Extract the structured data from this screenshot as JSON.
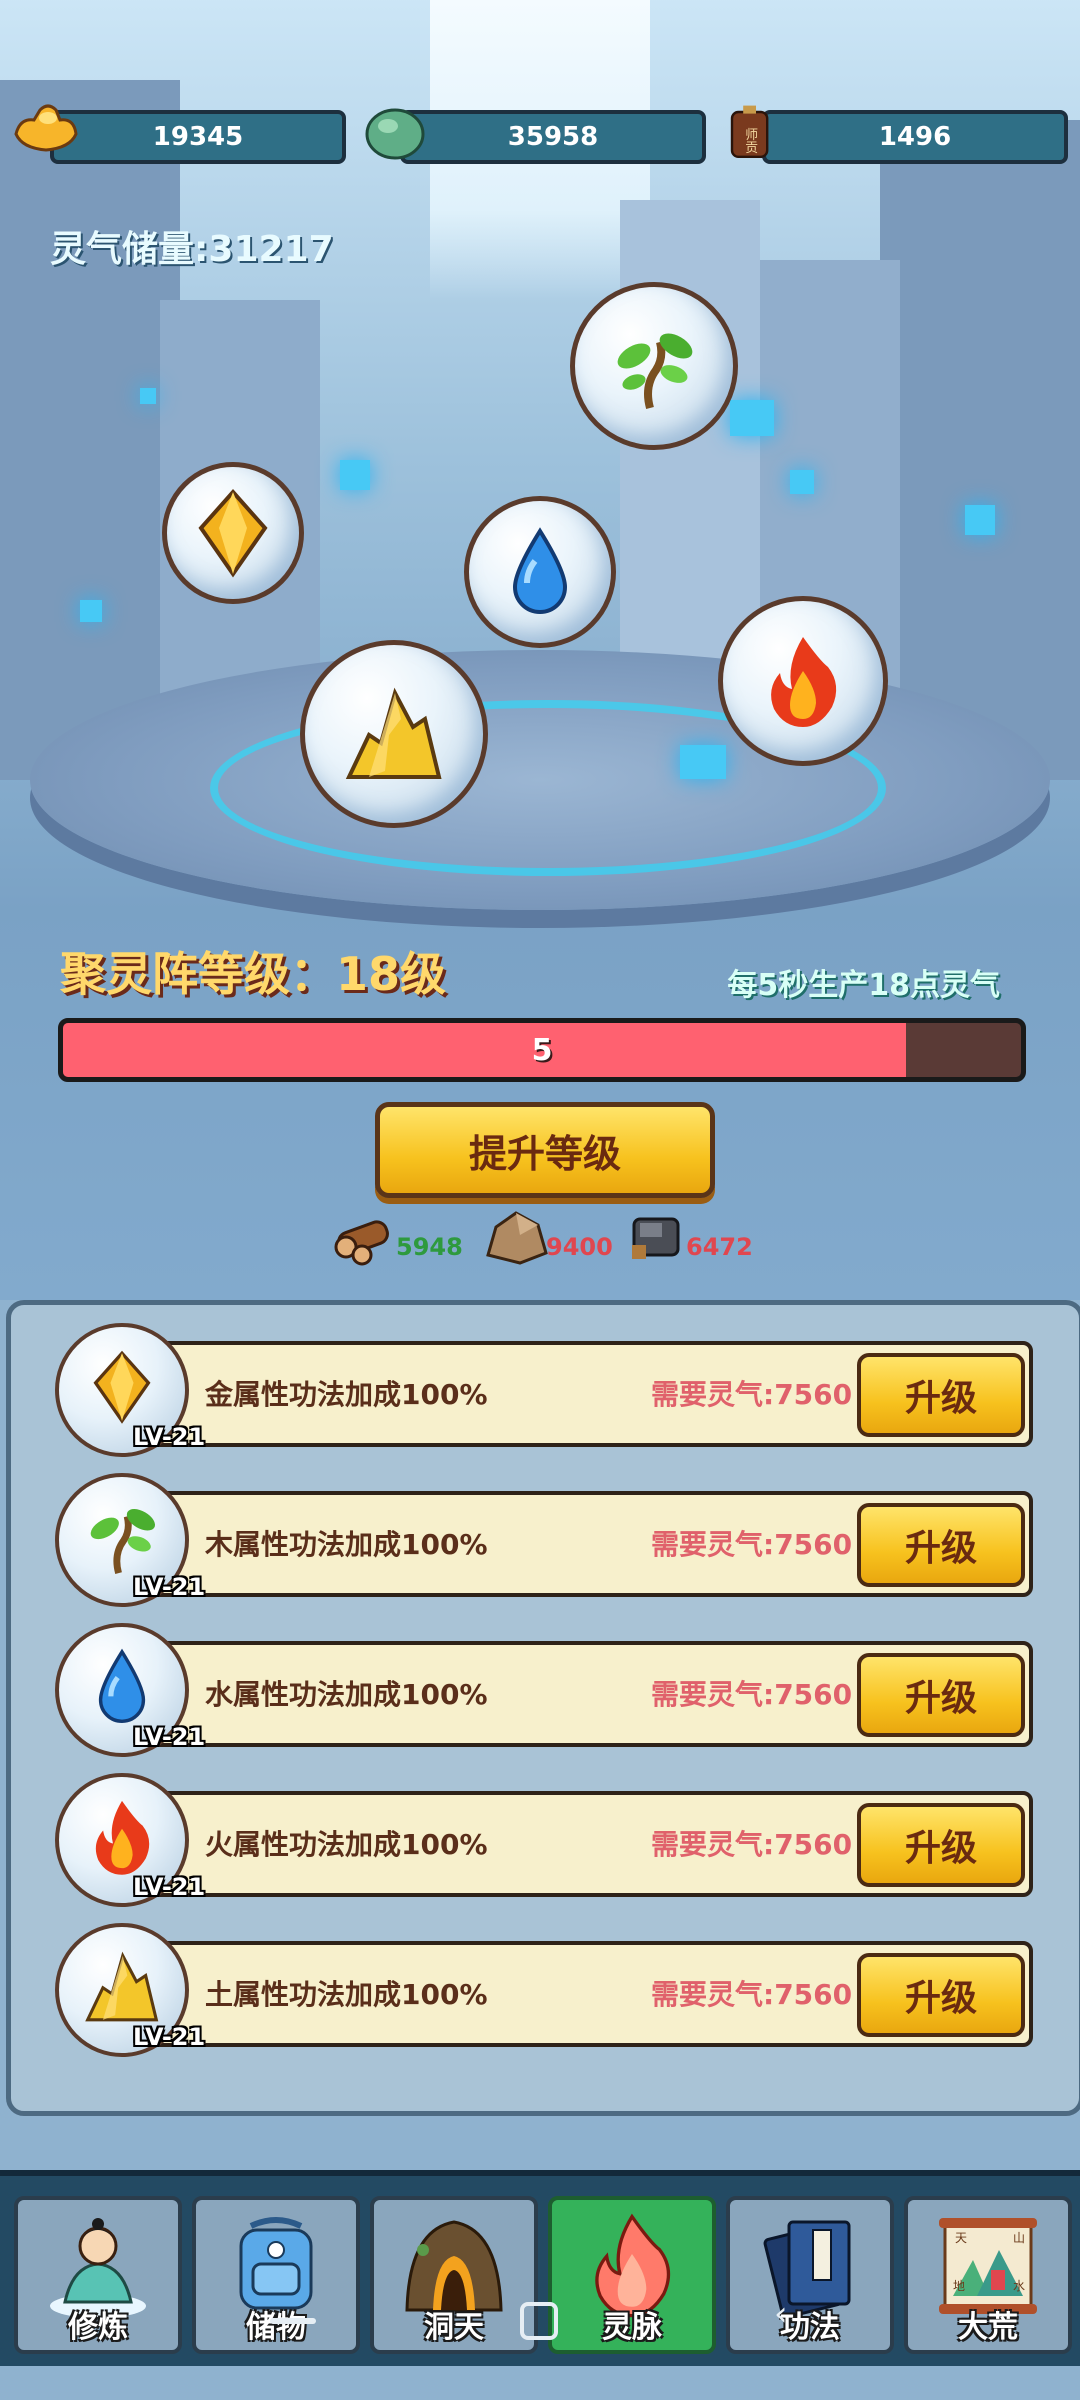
{
  "resources": [
    {
      "icon": "gold-ingot-icon",
      "value": "19345"
    },
    {
      "icon": "jade-stone-icon",
      "value": "35958"
    },
    {
      "icon": "master-token-icon",
      "value": "1496",
      "icon_text": "师贡"
    }
  ],
  "storage": {
    "label": "灵气储量:31217"
  },
  "array": {
    "level_label": "聚灵阵等级：18级",
    "rate_label": "每5秒生产18点灵气",
    "progress": {
      "value": "5",
      "fill_fraction": 0.88
    },
    "upgrade_label": "提升等级",
    "costs": [
      {
        "icon": "wood-log-icon",
        "value": "5948",
        "color": "#2e9a3e"
      },
      {
        "icon": "stone-icon",
        "value": "9400",
        "color": "#e0474f"
      },
      {
        "icon": "iron-ore-icon",
        "value": "6472",
        "color": "#e0474f"
      }
    ]
  },
  "attributes": [
    {
      "icon": "gold-crystal-icon",
      "level": "LV-21",
      "desc": "金属性功法加成100%",
      "cost": "需要灵气:7560",
      "button": "升级"
    },
    {
      "icon": "wood-sprout-icon",
      "level": "LV-21",
      "desc": "木属性功法加成100%",
      "cost": "需要灵气:7560",
      "button": "升级"
    },
    {
      "icon": "water-drop-icon",
      "level": "LV-21",
      "desc": "水属性功法加成100%",
      "cost": "需要灵气:7560",
      "button": "升级"
    },
    {
      "icon": "fire-flame-icon",
      "level": "LV-21",
      "desc": "火属性功法加成100%",
      "cost": "需要灵气:7560",
      "button": "升级"
    },
    {
      "icon": "earth-mountain-icon",
      "level": "LV-21",
      "desc": "土属性功法加成100%",
      "cost": "需要灵气:7560",
      "button": "升级"
    }
  ],
  "nav": [
    {
      "label": "修炼",
      "icon": "meditating-cultivator-icon",
      "active": false
    },
    {
      "label": "储物",
      "icon": "backpack-icon",
      "active": false
    },
    {
      "label": "洞天",
      "icon": "cave-icon",
      "active": false
    },
    {
      "label": "灵脉",
      "icon": "flame-icon",
      "active": true
    },
    {
      "label": "功法",
      "icon": "scripture-book-icon",
      "active": false
    },
    {
      "label": "大荒",
      "icon": "map-scroll-icon",
      "active": false
    }
  ],
  "map_scroll_text": [
    "天",
    "山",
    "地",
    "水"
  ],
  "colors": {
    "accent_gold": "#f7c21e",
    "progress_fill": "#ff6170",
    "active_tab": "#34b25a"
  }
}
